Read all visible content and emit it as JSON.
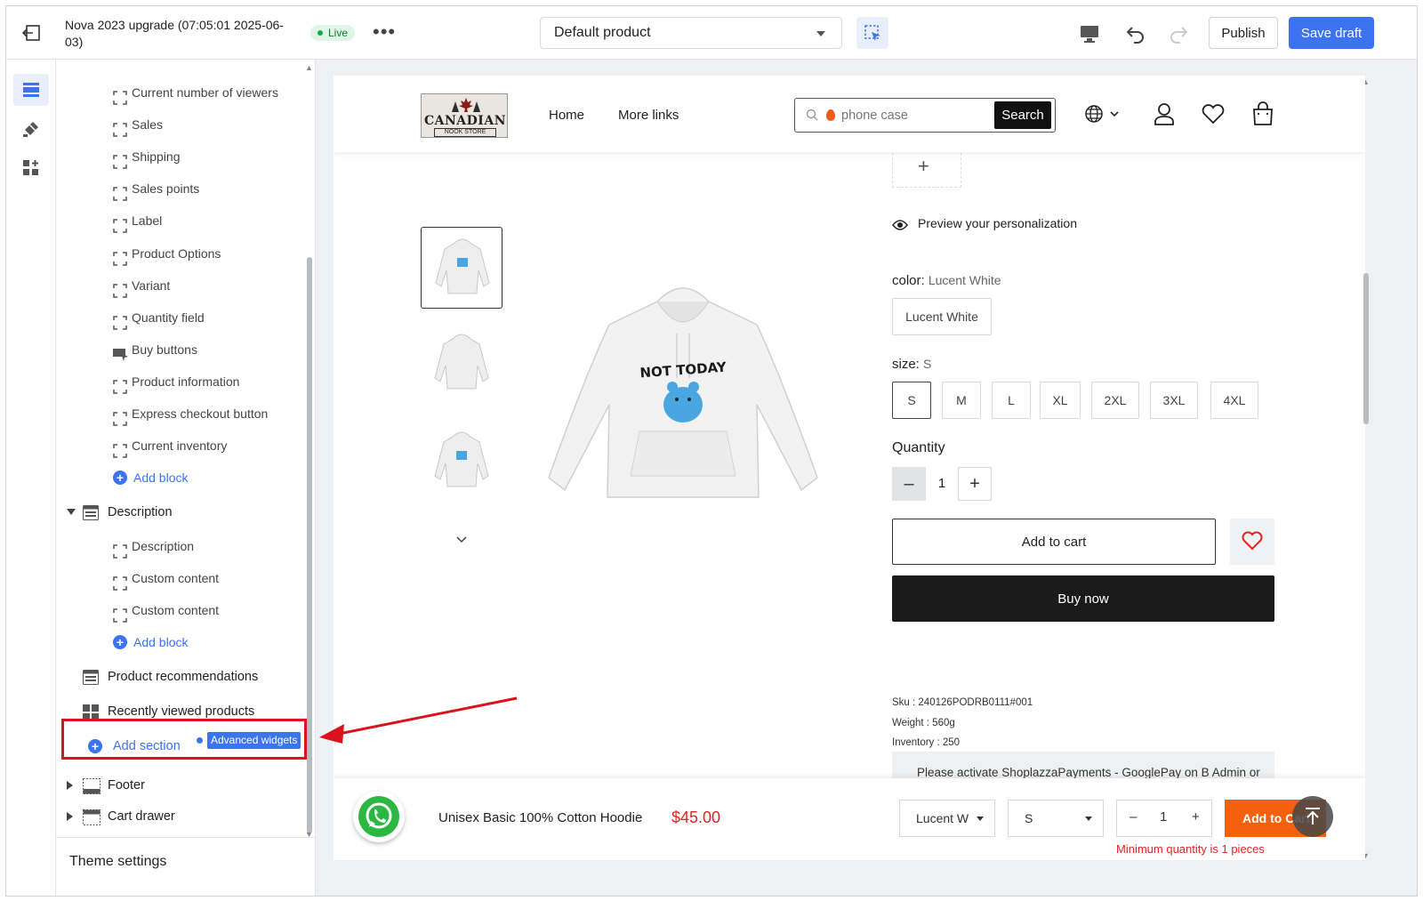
{
  "topbar": {
    "title": "Nova 2023 upgrade (07:05:01 2025-06-03)",
    "status": "Live",
    "template_select": "Default product",
    "publish_label": "Publish",
    "save_label": "Save draft"
  },
  "sidebar": {
    "blocks_a": [
      "Current number of viewers",
      "Sales",
      "Shipping",
      "Sales points",
      "Label",
      "Product Options",
      "Variant",
      "Quantity field",
      "Buy buttons",
      "Product information",
      "Express checkout button",
      "Current inventory"
    ],
    "add_block": "Add block",
    "section_description": "Description",
    "blocks_b": [
      "Description",
      "Custom content",
      "Custom content"
    ],
    "section_recommendations": "Product recommendations",
    "section_recently_viewed": "Recently viewed products",
    "add_section": "Add section",
    "advanced_widgets": "Advanced widgets",
    "section_footer": "Footer",
    "section_cart_drawer": "Cart drawer",
    "theme_settings": "Theme settings"
  },
  "store": {
    "logo_main": "CANADIAN",
    "logo_sub": "NOOK STORE",
    "nav": [
      "Home",
      "More links"
    ],
    "search_placeholder": "phone case",
    "search_button": "Search"
  },
  "product": {
    "preview_label": "Preview your personalization",
    "color_label": "color:",
    "color_value": "Lucent White",
    "color_options": [
      "Lucent White"
    ],
    "size_label": "size:",
    "size_value": "S",
    "size_options": [
      "S",
      "M",
      "L",
      "XL",
      "2XL",
      "3XL",
      "4XL"
    ],
    "quantity_label": "Quantity",
    "quantity": "1",
    "add_to_cart": "Add to cart",
    "buy_now": "Buy now",
    "sku": "Sku : 240126PODRB0111#001",
    "weight": "Weight : 560g",
    "inventory": "Inventory : 250",
    "notice": "Please activate ShoplazzaPayments - GooglePay on B Admin or",
    "print_text": "NOT TODAY"
  },
  "sticky": {
    "name": "Unisex Basic 100% Cotton Hoodie",
    "price": "$45.00",
    "color": "Lucent W",
    "size": "S",
    "qty": "1",
    "add_to_cart": "Add to Cart",
    "min_note": "Minimum quantity is 1 pieces"
  },
  "colors": {
    "accent": "#3b73f0",
    "highlight": "#d9141e",
    "price": "#e02424",
    "sticky_cta": "#f5600f"
  }
}
